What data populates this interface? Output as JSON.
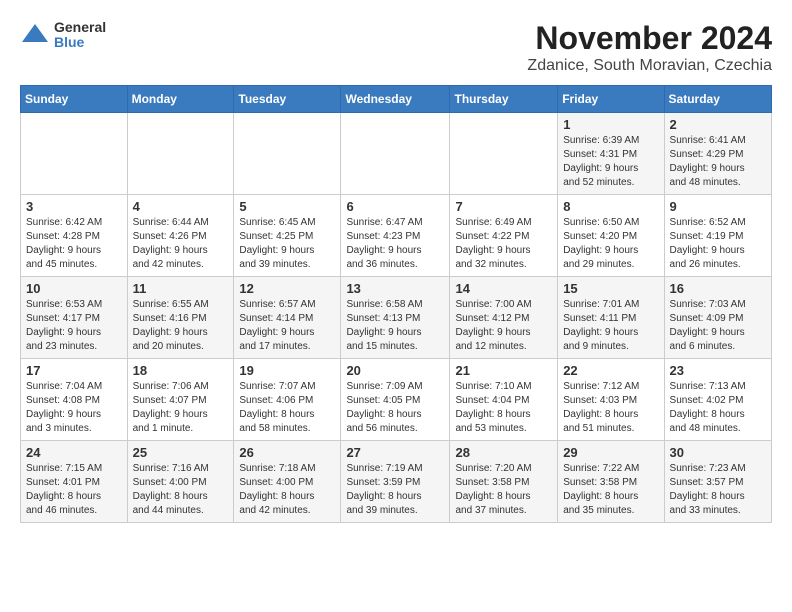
{
  "header": {
    "logo_general": "General",
    "logo_blue": "Blue",
    "month_title": "November 2024",
    "location": "Zdanice, South Moravian, Czechia"
  },
  "weekdays": [
    "Sunday",
    "Monday",
    "Tuesday",
    "Wednesday",
    "Thursday",
    "Friday",
    "Saturday"
  ],
  "weeks": [
    [
      {
        "day": "",
        "info": ""
      },
      {
        "day": "",
        "info": ""
      },
      {
        "day": "",
        "info": ""
      },
      {
        "day": "",
        "info": ""
      },
      {
        "day": "",
        "info": ""
      },
      {
        "day": "1",
        "info": "Sunrise: 6:39 AM\nSunset: 4:31 PM\nDaylight: 9 hours\nand 52 minutes."
      },
      {
        "day": "2",
        "info": "Sunrise: 6:41 AM\nSunset: 4:29 PM\nDaylight: 9 hours\nand 48 minutes."
      }
    ],
    [
      {
        "day": "3",
        "info": "Sunrise: 6:42 AM\nSunset: 4:28 PM\nDaylight: 9 hours\nand 45 minutes."
      },
      {
        "day": "4",
        "info": "Sunrise: 6:44 AM\nSunset: 4:26 PM\nDaylight: 9 hours\nand 42 minutes."
      },
      {
        "day": "5",
        "info": "Sunrise: 6:45 AM\nSunset: 4:25 PM\nDaylight: 9 hours\nand 39 minutes."
      },
      {
        "day": "6",
        "info": "Sunrise: 6:47 AM\nSunset: 4:23 PM\nDaylight: 9 hours\nand 36 minutes."
      },
      {
        "day": "7",
        "info": "Sunrise: 6:49 AM\nSunset: 4:22 PM\nDaylight: 9 hours\nand 32 minutes."
      },
      {
        "day": "8",
        "info": "Sunrise: 6:50 AM\nSunset: 4:20 PM\nDaylight: 9 hours\nand 29 minutes."
      },
      {
        "day": "9",
        "info": "Sunrise: 6:52 AM\nSunset: 4:19 PM\nDaylight: 9 hours\nand 26 minutes."
      }
    ],
    [
      {
        "day": "10",
        "info": "Sunrise: 6:53 AM\nSunset: 4:17 PM\nDaylight: 9 hours\nand 23 minutes."
      },
      {
        "day": "11",
        "info": "Sunrise: 6:55 AM\nSunset: 4:16 PM\nDaylight: 9 hours\nand 20 minutes."
      },
      {
        "day": "12",
        "info": "Sunrise: 6:57 AM\nSunset: 4:14 PM\nDaylight: 9 hours\nand 17 minutes."
      },
      {
        "day": "13",
        "info": "Sunrise: 6:58 AM\nSunset: 4:13 PM\nDaylight: 9 hours\nand 15 minutes."
      },
      {
        "day": "14",
        "info": "Sunrise: 7:00 AM\nSunset: 4:12 PM\nDaylight: 9 hours\nand 12 minutes."
      },
      {
        "day": "15",
        "info": "Sunrise: 7:01 AM\nSunset: 4:11 PM\nDaylight: 9 hours\nand 9 minutes."
      },
      {
        "day": "16",
        "info": "Sunrise: 7:03 AM\nSunset: 4:09 PM\nDaylight: 9 hours\nand 6 minutes."
      }
    ],
    [
      {
        "day": "17",
        "info": "Sunrise: 7:04 AM\nSunset: 4:08 PM\nDaylight: 9 hours\nand 3 minutes."
      },
      {
        "day": "18",
        "info": "Sunrise: 7:06 AM\nSunset: 4:07 PM\nDaylight: 9 hours\nand 1 minute."
      },
      {
        "day": "19",
        "info": "Sunrise: 7:07 AM\nSunset: 4:06 PM\nDaylight: 8 hours\nand 58 minutes."
      },
      {
        "day": "20",
        "info": "Sunrise: 7:09 AM\nSunset: 4:05 PM\nDaylight: 8 hours\nand 56 minutes."
      },
      {
        "day": "21",
        "info": "Sunrise: 7:10 AM\nSunset: 4:04 PM\nDaylight: 8 hours\nand 53 minutes."
      },
      {
        "day": "22",
        "info": "Sunrise: 7:12 AM\nSunset: 4:03 PM\nDaylight: 8 hours\nand 51 minutes."
      },
      {
        "day": "23",
        "info": "Sunrise: 7:13 AM\nSunset: 4:02 PM\nDaylight: 8 hours\nand 48 minutes."
      }
    ],
    [
      {
        "day": "24",
        "info": "Sunrise: 7:15 AM\nSunset: 4:01 PM\nDaylight: 8 hours\nand 46 minutes."
      },
      {
        "day": "25",
        "info": "Sunrise: 7:16 AM\nSunset: 4:00 PM\nDaylight: 8 hours\nand 44 minutes."
      },
      {
        "day": "26",
        "info": "Sunrise: 7:18 AM\nSunset: 4:00 PM\nDaylight: 8 hours\nand 42 minutes."
      },
      {
        "day": "27",
        "info": "Sunrise: 7:19 AM\nSunset: 3:59 PM\nDaylight: 8 hours\nand 39 minutes."
      },
      {
        "day": "28",
        "info": "Sunrise: 7:20 AM\nSunset: 3:58 PM\nDaylight: 8 hours\nand 37 minutes."
      },
      {
        "day": "29",
        "info": "Sunrise: 7:22 AM\nSunset: 3:58 PM\nDaylight: 8 hours\nand 35 minutes."
      },
      {
        "day": "30",
        "info": "Sunrise: 7:23 AM\nSunset: 3:57 PM\nDaylight: 8 hours\nand 33 minutes."
      }
    ]
  ]
}
